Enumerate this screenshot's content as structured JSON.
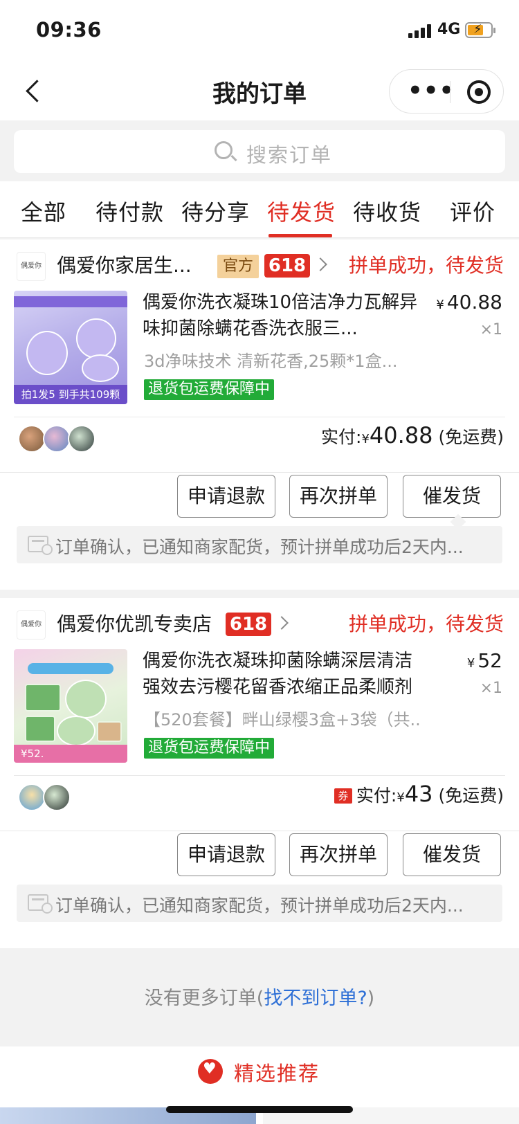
{
  "status_bar": {
    "time": "09:36",
    "network": "4G"
  },
  "nav": {
    "title": "我的订单"
  },
  "search": {
    "placeholder": "搜索订单"
  },
  "tabs": [
    "全部",
    "待付款",
    "待分享",
    "待发货",
    "待收货",
    "评价"
  ],
  "active_tab": "待发货",
  "orders": [
    {
      "shop_logo": "偶爱你",
      "shop_name": "偶爱你家居生...",
      "official_tag": "官方",
      "badge": "618",
      "status": "拼单成功，待发货",
      "product_title": "偶爱你洗衣凝珠10倍洁净力瓦解异味抑菌除螨花香洗衣服三...",
      "price": "40.88",
      "currency": "¥",
      "quantity": "×1",
      "spec": "3d净味技术 清新花香,25颗*1盒...",
      "guarantee": "退货包运费保障中",
      "thumb_promo": "拍1发5 到手共109颗",
      "paid_label": "实付:",
      "paid_amount": "40.88",
      "shipping": "(免运费)",
      "buttons": [
        "申请退款",
        "再次拼单",
        "催发货"
      ],
      "notice": "订单确认，已通知商家配货，预计拼单成功后2天内..."
    },
    {
      "shop_logo": "偶爱你",
      "shop_name": "偶爱你优凯专卖店",
      "badge": "618",
      "status": "拼单成功，待发货",
      "product_title": "偶爱你洗衣凝珠抑菌除螨深层清洁强效去污樱花留香浓缩正品柔顺剂",
      "price": "52",
      "currency": "¥",
      "quantity": "×1",
      "spec": "【520套餐】畔山绿樱3盒+3袋（共...",
      "guarantee": "退货包运费保障中",
      "thumb_promo": "¥52.",
      "coupon_icon": "券",
      "paid_label": "实付:",
      "paid_amount": "43",
      "shipping": "(免运费)",
      "buttons": [
        "申请退款",
        "再次拼单",
        "催发货"
      ],
      "notice": "订单确认，已通知商家配货，预计拼单成功后2天内..."
    }
  ],
  "footer": {
    "no_more_prefix": "没有更多订单(",
    "no_more_link": "找不到订单?",
    "no_more_suffix": ")",
    "recommend_title": "精选推荐"
  },
  "colors": {
    "accent_red": "#e02e24",
    "guarantee_green": "#22ab38",
    "link_blue": "#2d6fd6"
  }
}
